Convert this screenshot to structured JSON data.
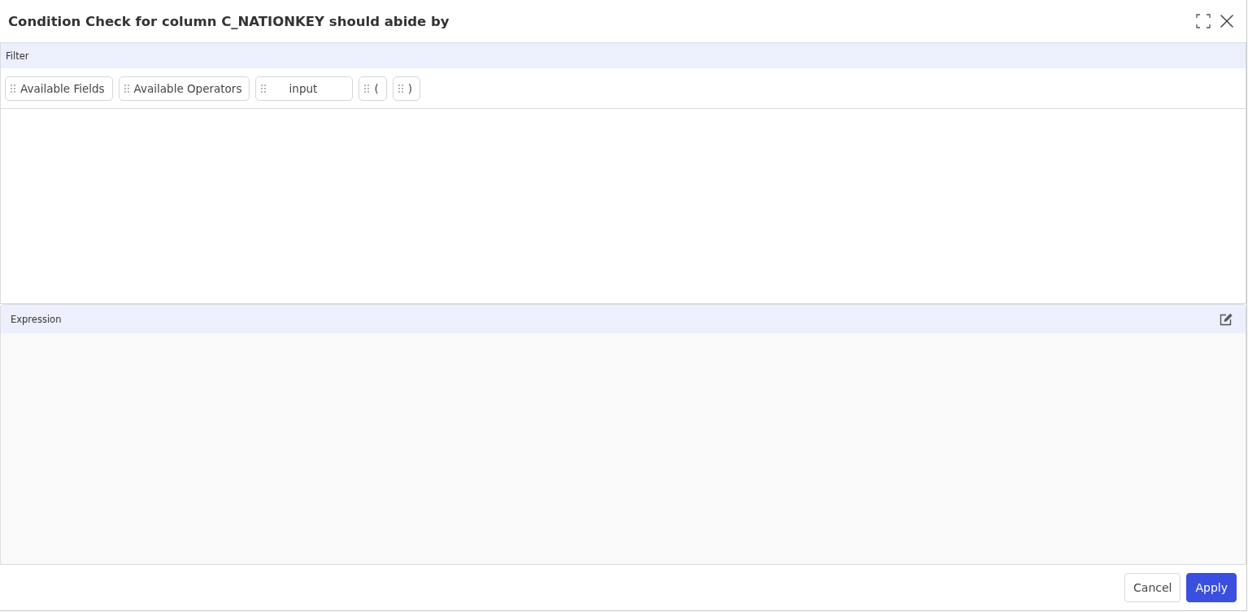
{
  "dialog": {
    "title": "Condition Check for column **C_NATIONKEY** should abide by"
  },
  "filter": {
    "header": "Filter",
    "chips": [
      {
        "label": "Available Fields",
        "kind": "token"
      },
      {
        "label": "Available Operators",
        "kind": "token"
      },
      {
        "label": "input",
        "kind": "input"
      },
      {
        "label": "(",
        "kind": "token"
      },
      {
        "label": ")",
        "kind": "token"
      }
    ]
  },
  "expression": {
    "header": "Expression"
  },
  "buttons": [
    {
      "label": "Cancel",
      "kind": "secondary"
    },
    {
      "label": "Apply",
      "kind": "primary"
    }
  ]
}
